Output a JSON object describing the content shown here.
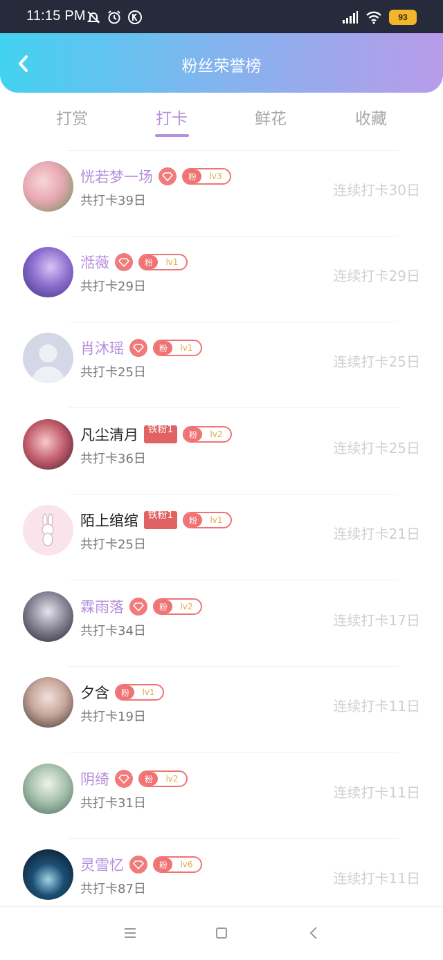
{
  "status_bar": {
    "time": "11:15 PM",
    "battery": "93"
  },
  "header": {
    "title": "粉丝荣誉榜"
  },
  "tabs": [
    {
      "label": "打赏",
      "active": false
    },
    {
      "label": "打卡",
      "active": true
    },
    {
      "label": "鲜花",
      "active": false
    },
    {
      "label": "收藏",
      "active": false
    }
  ],
  "fans": [
    {
      "name": "恍若梦一场",
      "vip": true,
      "iron_badge": null,
      "fan_label": "粉",
      "level": "lv3",
      "total": "共打卡39日",
      "streak": "连续打卡30日"
    },
    {
      "name": "湉薇",
      "vip": true,
      "iron_badge": null,
      "fan_label": "粉",
      "level": "lv1",
      "total": "共打卡29日",
      "streak": "连续打卡29日"
    },
    {
      "name": "肖沐瑶",
      "vip": true,
      "iron_badge": null,
      "fan_label": "粉",
      "level": "lv1",
      "total": "共打卡25日",
      "streak": "连续打卡25日"
    },
    {
      "name": "凡尘清月",
      "vip": false,
      "iron_badge": "铁粉1",
      "fan_label": "粉",
      "level": "lv2",
      "total": "共打卡36日",
      "streak": "连续打卡25日"
    },
    {
      "name": "陌上绾绾",
      "vip": false,
      "iron_badge": "铁粉1",
      "fan_label": "粉",
      "level": "lv1",
      "total": "共打卡25日",
      "streak": "连续打卡21日"
    },
    {
      "name": "霖雨落",
      "vip": true,
      "iron_badge": null,
      "fan_label": "粉",
      "level": "lv2",
      "total": "共打卡34日",
      "streak": "连续打卡17日"
    },
    {
      "name": "夕含",
      "vip": false,
      "iron_badge": null,
      "fan_label": "粉",
      "level": "lv1",
      "total": "共打卡19日",
      "streak": "连续打卡11日"
    },
    {
      "name": "阴绮",
      "vip": true,
      "iron_badge": null,
      "fan_label": "粉",
      "level": "lv2",
      "total": "共打卡31日",
      "streak": "连续打卡11日"
    },
    {
      "name": "灵雪忆",
      "vip": true,
      "iron_badge": null,
      "fan_label": "粉",
      "level": "lv6",
      "total": "共打卡87日",
      "streak": "连续打卡11日"
    }
  ],
  "colors": {
    "accent": "#b68edc",
    "badge_red": "#ef7373",
    "header_start": "#42d2f0",
    "header_end": "#b89be9"
  }
}
